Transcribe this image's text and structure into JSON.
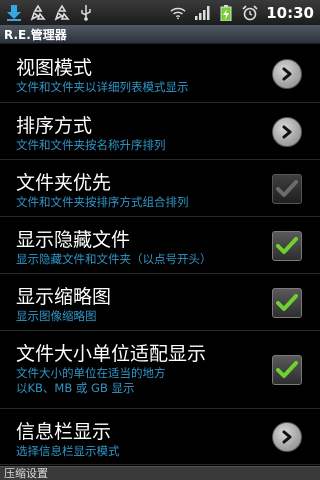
{
  "status_bar": {
    "icons_left": [
      "download-icon",
      "recycle-icon",
      "recycle-icon",
      "usb-icon"
    ],
    "icons_right": [
      "wifi-icon",
      "signal-icon",
      "battery-icon",
      "alarm-icon"
    ],
    "time": "10:30"
  },
  "title": "R.E.管理器",
  "preferences": [
    {
      "title": "视图模式",
      "summary": [
        "文件和文件夹以详细列表模式显示"
      ],
      "widget": "arrow",
      "checked": null,
      "enabled": true
    },
    {
      "title": "排序方式",
      "summary": [
        "文件和文件夹按名称升序排列"
      ],
      "widget": "arrow",
      "checked": null,
      "enabled": true
    },
    {
      "title": "文件夹优先",
      "summary": [
        "文件和文件夹按排序方式组合排列"
      ],
      "widget": "checkbox",
      "checked": true,
      "enabled": false
    },
    {
      "title": "显示隐藏文件",
      "summary": [
        "显示隐藏文件和文件夹（以点号开头）"
      ],
      "widget": "checkbox",
      "checked": true,
      "enabled": true
    },
    {
      "title": "显示缩略图",
      "summary": [
        "显示图像缩略图"
      ],
      "widget": "checkbox",
      "checked": true,
      "enabled": true
    },
    {
      "title": "文件大小单位适配显示",
      "summary": [
        "文件大小的单位在适当的地方",
        "以KB、MB 或 GB 显示"
      ],
      "widget": "checkbox",
      "checked": true,
      "enabled": true
    },
    {
      "title": "信息栏显示",
      "summary": [
        "选择信息栏显示模式"
      ],
      "widget": "arrow",
      "checked": null,
      "enabled": true
    }
  ],
  "category_header": "压缩设置",
  "colors": {
    "summary_text": "#2f96c8",
    "check_enabled": "#6fd02f",
    "check_disabled": "#9a9a9a"
  }
}
